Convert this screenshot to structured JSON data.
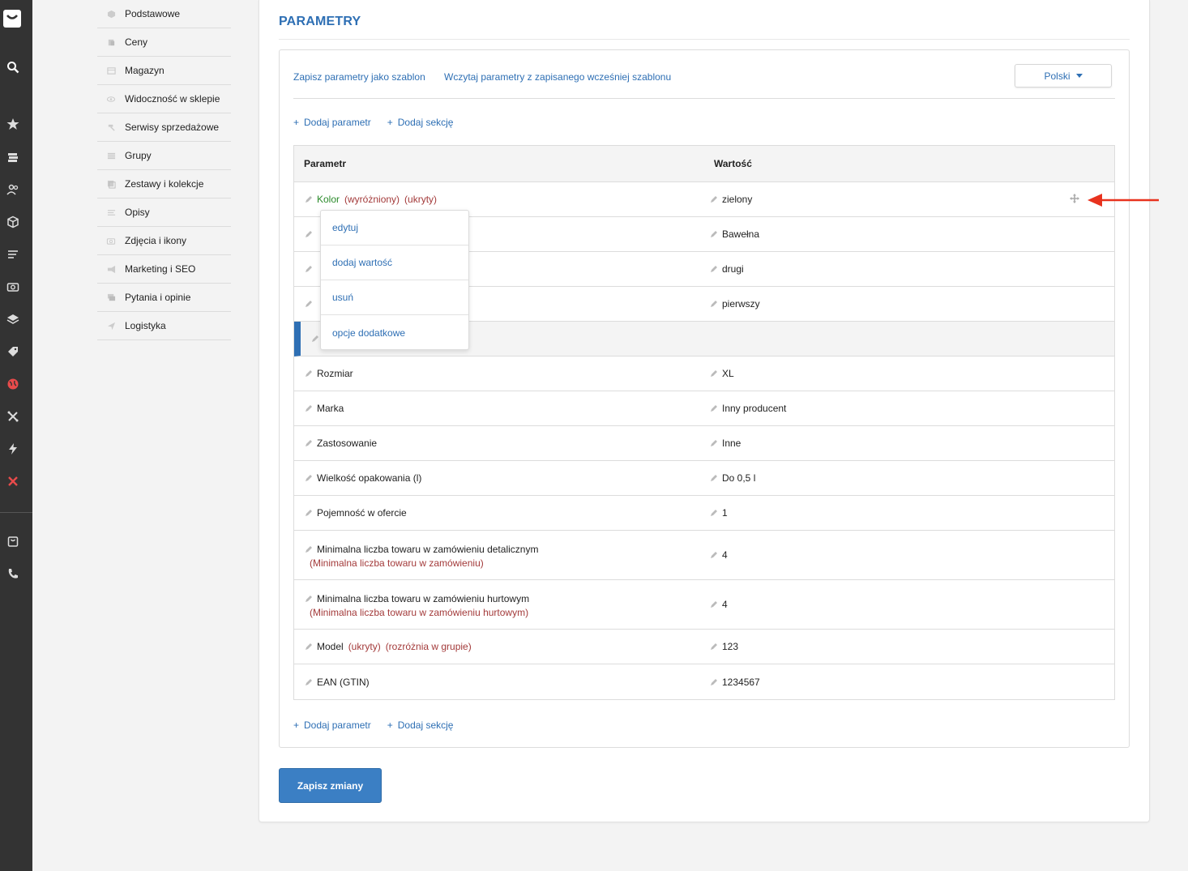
{
  "rail": {
    "icons": [
      "logo-icon",
      "search-icon",
      "star-icon",
      "stack-icon",
      "users-icon",
      "box-icon",
      "list-icon",
      "camera-icon",
      "layers-icon",
      "tag-icon",
      "globe-icon",
      "tools-icon",
      "bolt-icon",
      "puzzle-icon",
      "bag-icon",
      "phone-icon"
    ],
    "accent": "#e84b4b"
  },
  "subnav": {
    "items": [
      {
        "label": "Podstawowe",
        "icon": "box-icon"
      },
      {
        "label": "Ceny",
        "icon": "price-icon"
      },
      {
        "label": "Magazyn",
        "icon": "warehouse-icon"
      },
      {
        "label": "Widoczność w sklepie",
        "icon": "eye-icon"
      },
      {
        "label": "Serwisy sprzedażowe",
        "icon": "hammer-icon"
      },
      {
        "label": "Grupy",
        "icon": "stack-icon"
      },
      {
        "label": "Zestawy i kolekcje",
        "icon": "collection-icon"
      },
      {
        "label": "Opisy",
        "icon": "text-icon"
      },
      {
        "label": "Zdjęcia i ikony",
        "icon": "camera-icon"
      },
      {
        "label": "Marketing i SEO",
        "icon": "megaphone-icon"
      },
      {
        "label": "Pytania i opinie",
        "icon": "comment-icon"
      },
      {
        "label": "Logistyka",
        "icon": "send-icon"
      }
    ]
  },
  "panel": {
    "title": "PARAMETRY",
    "template_save": "Zapisz parametry jako szablon",
    "template_load": "Wczytaj parametry z zapisanego wcześniej szablonu",
    "language": "Polski",
    "add_param": "Dodaj parametr",
    "add_section": "Dodaj sekcję",
    "plus": "+",
    "save_button": "Zapisz zmiany"
  },
  "table": {
    "headers": {
      "param": "Parametr",
      "value": "Wartość"
    },
    "rows": [
      {
        "name": "Kolor",
        "green": true,
        "flags": [
          "(wyróżniony)",
          "(ukryty)"
        ],
        "value": "zielony",
        "move": true
      },
      {
        "name": "",
        "value": "Bawełna"
      },
      {
        "name": "",
        "value": "drugi"
      },
      {
        "name": "",
        "value": "pierwszy"
      },
      {
        "section": true
      },
      {
        "name": "Rozmiar",
        "value": "XL"
      },
      {
        "name": "Marka",
        "value": "Inny producent"
      },
      {
        "name": "Zastosowanie",
        "value": "Inne"
      },
      {
        "name": "Wielkość opakowania (l)",
        "value": "Do 0,5 l"
      },
      {
        "name": "Pojemność w ofercie",
        "value": "1"
      },
      {
        "name": "Minimalna liczba towaru w zamówieniu detalicznym",
        "alias": "(Minimalna liczba towaru w zamówieniu)",
        "value": "4"
      },
      {
        "name": "Minimalna liczba towaru w zamówieniu hurtowym",
        "alias": "(Minimalna liczba towaru w zamówieniu hurtowym)",
        "value": "4"
      },
      {
        "name": "Model",
        "flags": [
          "(ukryty)",
          "(rozróżnia w grupie)"
        ],
        "value": "123"
      },
      {
        "name": "EAN (GTIN)",
        "value": "1234567"
      }
    ]
  },
  "context_menu": {
    "items": [
      "edytuj",
      "dodaj wartość",
      "usuń",
      "opcje dodatkowe"
    ]
  },
  "colors": {
    "link": "#2e6fb4",
    "param_highlight": "#2a8a2a",
    "flag": "#a33a3a",
    "save": "#3b7fc4",
    "annotation": "#e8321e"
  }
}
